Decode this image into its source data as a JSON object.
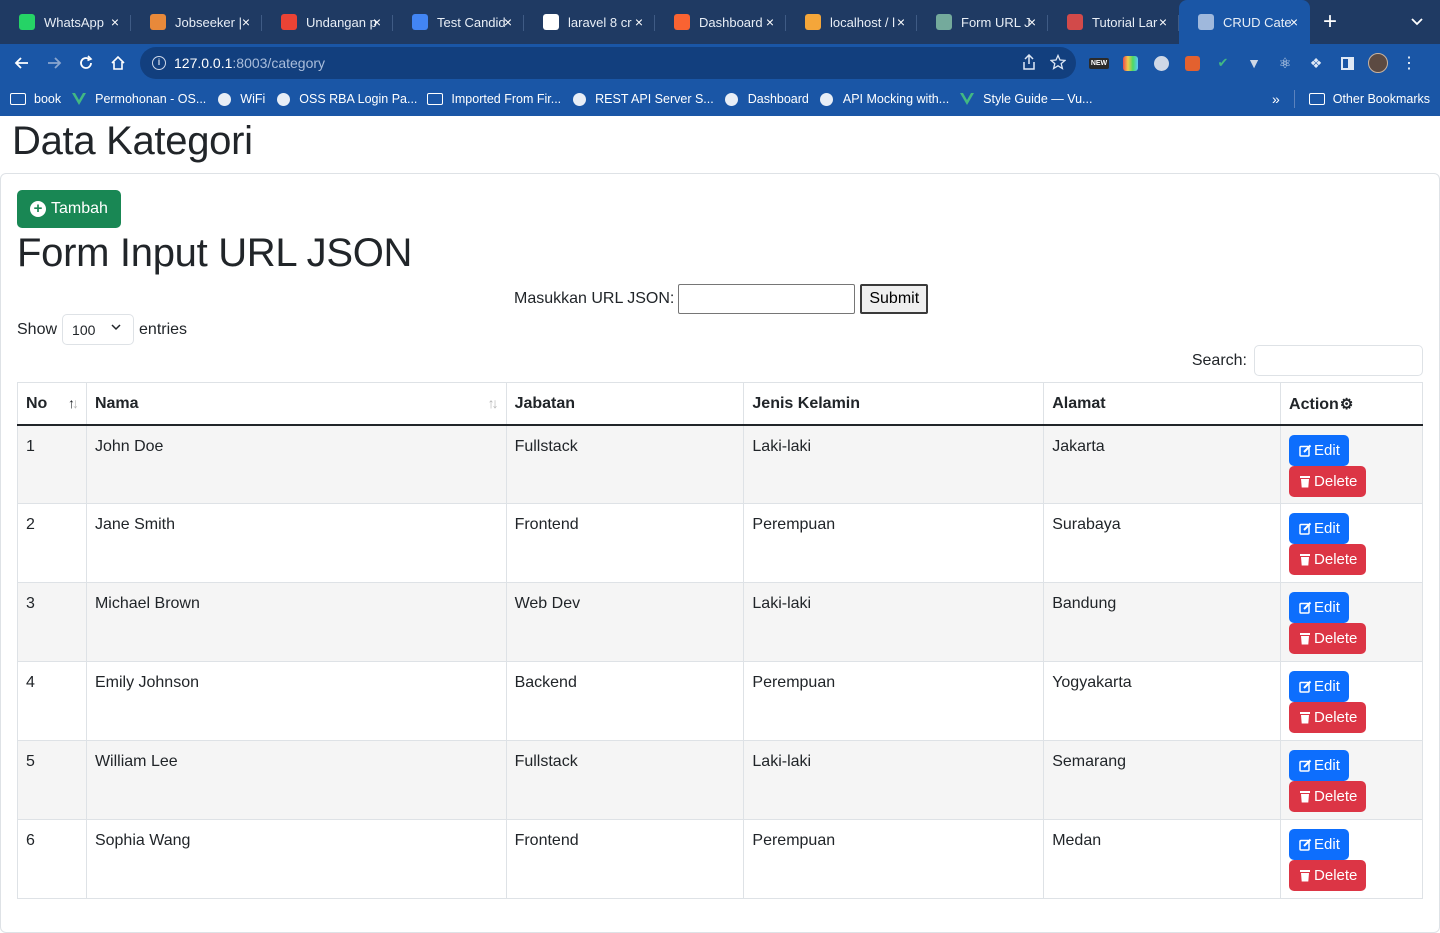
{
  "browser": {
    "tabs": [
      {
        "label": "WhatsApp",
        "icon": "whatsapp-icon",
        "color": "#25d366"
      },
      {
        "label": "Jobseeker |",
        "icon": "jobseeker-icon",
        "color": "#e8893a"
      },
      {
        "label": "Undangan p",
        "icon": "gmail-icon",
        "color": "#ea4335"
      },
      {
        "label": "Test Candid",
        "icon": "docs-icon",
        "color": "#4285f4"
      },
      {
        "label": "laravel 8 cr",
        "icon": "google-icon",
        "color": "#ffffff"
      },
      {
        "label": "Dashboard",
        "icon": "xampp-icon",
        "color": "#f96332"
      },
      {
        "label": "localhost / l",
        "icon": "phpmyadmin-icon",
        "color": "#f4a63a"
      },
      {
        "label": "Form URL J",
        "icon": "chatgpt-icon",
        "color": "#74aa9c"
      },
      {
        "label": "Tutorial Lar",
        "icon": "tutorial-icon",
        "color": "#d24a4a"
      },
      {
        "label": "CRUD Cate",
        "icon": "globe-icon",
        "color": "#9fb8dc"
      }
    ],
    "url_host": "127.0.0.1",
    "url_path": ":8003/category",
    "bookmarks": [
      {
        "label": "book",
        "icon": "folder-icon"
      },
      {
        "label": "Permohonan - OS...",
        "icon": "vue-icon"
      },
      {
        "label": "WiFi",
        "icon": "wifi-icon"
      },
      {
        "label": "OSS RBA Login Pa...",
        "icon": "oss-icon"
      },
      {
        "label": "Imported From Fir...",
        "icon": "folder-icon"
      },
      {
        "label": "REST API Server S...",
        "icon": "rest-icon"
      },
      {
        "label": "Dashboard",
        "icon": "dashboard-icon"
      },
      {
        "label": "API Mocking with...",
        "icon": "mock-icon"
      },
      {
        "label": "Style Guide — Vu...",
        "icon": "vue-icon"
      }
    ],
    "other_bookmarks": "Other Bookmarks"
  },
  "page": {
    "title": "Data Kategori",
    "add_button": "Tambah",
    "form_heading": "Form Input URL JSON",
    "url_label": "Masukkan URL JSON:",
    "submit_label": "Submit",
    "show_label": "Show",
    "entries_value": "100",
    "entries_label": "entries",
    "search_label": "Search:"
  },
  "table": {
    "headers": [
      "No",
      "Nama",
      "Jabatan",
      "Jenis Kelamin",
      "Alamat",
      "Action"
    ],
    "edit_label": "Edit",
    "delete_label": "Delete",
    "rows": [
      {
        "no": "1",
        "nama": "John Doe",
        "jabatan": "Fullstack",
        "jk": "Laki-laki",
        "alamat": "Jakarta"
      },
      {
        "no": "2",
        "nama": "Jane Smith",
        "jabatan": "Frontend",
        "jk": "Perempuan",
        "alamat": "Surabaya"
      },
      {
        "no": "3",
        "nama": "Michael Brown",
        "jabatan": "Web Dev",
        "jk": "Laki-laki",
        "alamat": "Bandung"
      },
      {
        "no": "4",
        "nama": "Emily Johnson",
        "jabatan": "Backend",
        "jk": "Perempuan",
        "alamat": "Yogyakarta"
      },
      {
        "no": "5",
        "nama": "William Lee",
        "jabatan": "Fullstack",
        "jk": "Laki-laki",
        "alamat": "Semarang"
      },
      {
        "no": "6",
        "nama": "Sophia Wang",
        "jabatan": "Frontend",
        "jk": "Perempuan",
        "alamat": "Medan"
      }
    ]
  },
  "colors": {
    "chrome_dark": "#1f3a63",
    "chrome": "#1a56a6",
    "success": "#198754",
    "primary": "#0d6efd",
    "danger": "#dc3545"
  }
}
